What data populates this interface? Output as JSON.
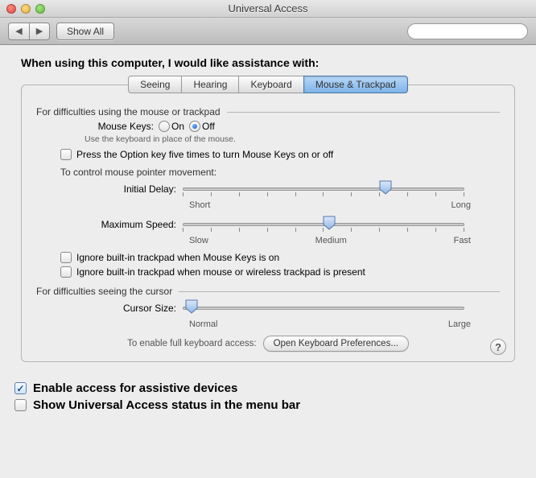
{
  "window": {
    "title": "Universal Access"
  },
  "toolbar": {
    "showAll": "Show All",
    "searchPlaceholder": ""
  },
  "header": "When using this computer, I would like assistance with:",
  "tabs": [
    "Seeing",
    "Hearing",
    "Keyboard",
    "Mouse & Trackpad"
  ],
  "section1": {
    "title": "For difficulties using the mouse or trackpad",
    "mouseKeysLabel": "Mouse Keys:",
    "on": "On",
    "off": "Off",
    "hint": "Use the keyboard in place of the mouse.",
    "optionFive": "Press the Option key five times to turn Mouse Keys on or off",
    "controlLabel": "To control mouse pointer movement:",
    "initialDelay": {
      "label": "Initial Delay:",
      "short": "Short",
      "long": "Long"
    },
    "maxSpeed": {
      "label": "Maximum Speed:",
      "slow": "Slow",
      "medium": "Medium",
      "fast": "Fast"
    },
    "ignoreTrackpadMouseKeys": "Ignore built-in trackpad when Mouse Keys is on",
    "ignoreTrackpadMouse": "Ignore built-in trackpad when mouse or wireless trackpad is present"
  },
  "section2": {
    "title": "For difficulties seeing the cursor",
    "cursorSize": {
      "label": "Cursor Size:",
      "normal": "Normal",
      "large": "Large"
    }
  },
  "kbAccess": {
    "text": "To enable full keyboard access:",
    "button": "Open Keyboard Preferences..."
  },
  "footer": {
    "enableAssistive": "Enable access for assistive devices",
    "showMenuBar": "Show Universal Access status in the menu bar"
  }
}
